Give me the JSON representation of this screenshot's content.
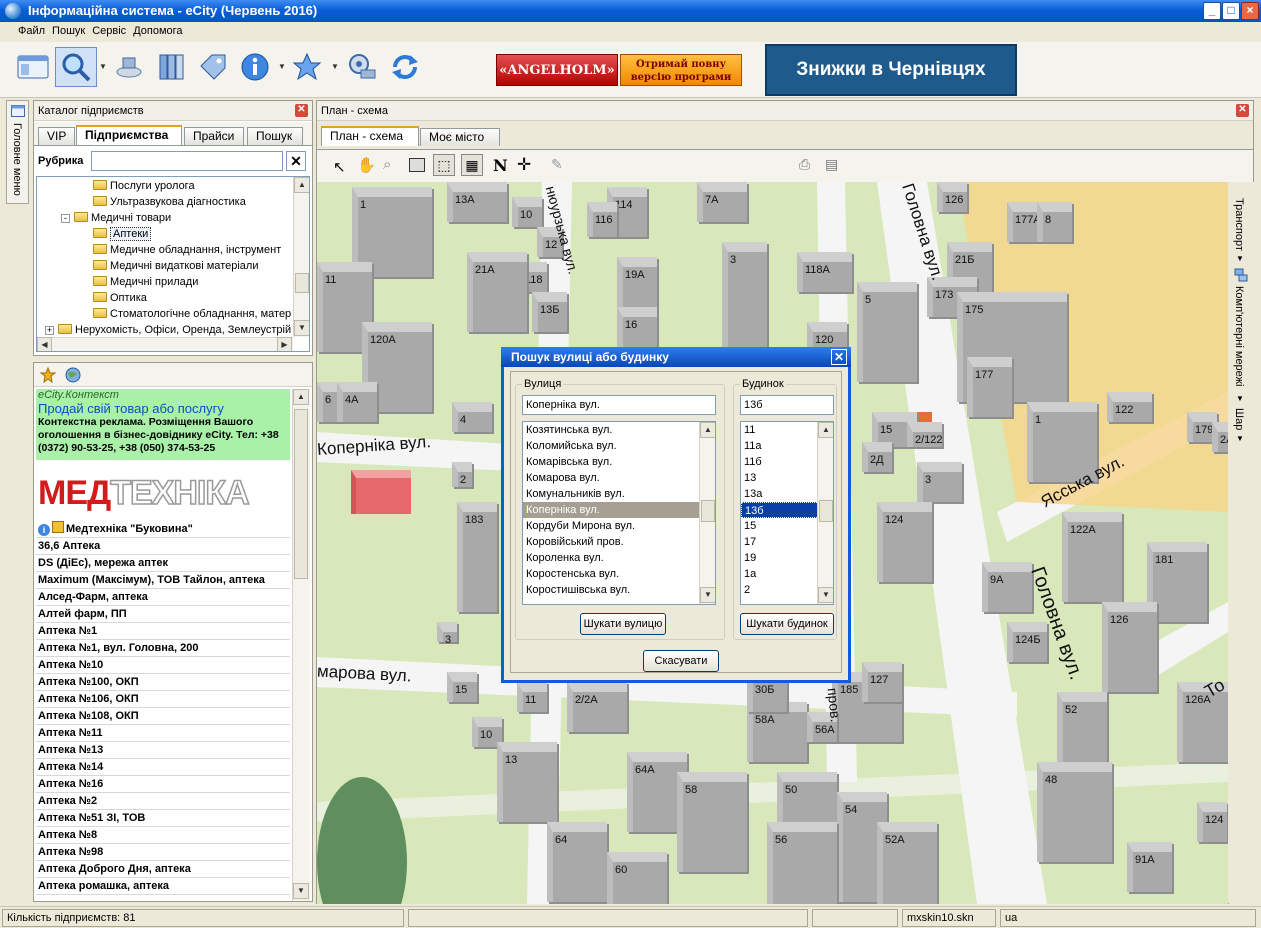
{
  "window": {
    "title": "Інформаційна система - eCity (Червень 2016)"
  },
  "menu": [
    "Файл",
    "Пошук",
    "Сервіс",
    "Допомога"
  ],
  "ads": {
    "angelholm": "«ANGELHOLM»",
    "full_version_line1": "Отримай повну",
    "full_version_line2": "версію програми",
    "discounts": "Знижки в Чернівцях"
  },
  "left_strip": {
    "label": "Головне меню"
  },
  "catalog": {
    "title": "Каталог підприємств",
    "tabs": [
      "VIP",
      "Підприємства",
      "Прайси",
      "Пошук"
    ],
    "active_tab": "Підприємства",
    "rubric_label": "Рубрика",
    "rubric_value": "",
    "tree": [
      "Послуги уролога",
      "Ультразвукова діагностика",
      "Медичні товари",
      "Аптеки",
      "Медичне обладнання, інструмент",
      "Медичні видаткові матеріали",
      "Медичні прилади",
      "Оптика",
      "Стоматологічне обладнання, матер",
      "Нерухомість, Офіси, Оренда, Землеустрій"
    ]
  },
  "ad_block": {
    "brand": "eCity.Контекст",
    "headline": "Продай свій товар або послугу",
    "body": "Контекстна реклама. Розміщення Вашого оголошення в бізнес-довіднику eCity. Тел: +38 (0372) 90-53-25, +38 (050) 374-53-25",
    "logo_part1": "МЕД",
    "logo_part2": "ТЕХНІКА"
  },
  "companies": [
    "Медтехніка \"Буковина\"",
    "36,6 Аптека",
    "DS (ДіЕс), мережа аптек",
    "Maximum (Максімум), ТОВ Тайлон, аптека",
    "Алсед-Фарм, аптека",
    "Алтей фарм, ПП",
    "Аптека №1",
    "Аптека №1, вул. Головна, 200",
    "Аптека №10",
    "Аптека №100, ОКП",
    "Аптека №106, ОКП",
    "Аптека №108, ОКП",
    "Аптека №11",
    "Аптека №13",
    "Аптека №14",
    "Аптека №16",
    "Аптека №2",
    "Аптека №51 ЗІ, ТОВ",
    "Аптека №8",
    "Аптека №98",
    "Аптека Доброго Дня, аптека",
    "Аптека ромашка, аптека"
  ],
  "map_panel": {
    "title": "План - схема",
    "tabs": [
      "План - схема",
      "Моє місто"
    ],
    "active_tab": "План - схема"
  },
  "map": {
    "streets": [
      "Коперніка вул.",
      "Головна вул.",
      "Ясська вул.",
      "марова вул.",
      "нюурзька вул.",
      "пров.",
      "Головна вул.",
      "То"
    ],
    "buildings": [
      "13А",
      "7А",
      "10",
      "114",
      "116",
      "1",
      "12",
      "19А",
      "3",
      "118А",
      "118",
      "11",
      "21А",
      "13Б",
      "16",
      "5",
      "120",
      "120А",
      "21Б",
      "173",
      "175",
      "177",
      "177А",
      "8",
      "6",
      "4А",
      "4",
      "2",
      "15",
      "2/122",
      "2Д",
      "122",
      "1",
      "179",
      "2А",
      "3",
      "124",
      "122А",
      "181",
      "183",
      "9А",
      "124Б",
      "126",
      "185",
      "52",
      "126А",
      "2/2А",
      "58А",
      "56А",
      "10",
      "13",
      "64А",
      "58",
      "50",
      "54",
      "48",
      "64",
      "56",
      "60",
      "52А",
      "91А",
      "11",
      "15",
      "30Б",
      "127",
      "124",
      "126",
      "3",
      "2"
    ]
  },
  "right_strip": [
    "Транспорт",
    "Комп'ютерні мережі",
    "Шар"
  ],
  "dialog": {
    "title": "Пошук вулиці або будинку",
    "street_group": "Вулиця",
    "street_value": "Коперніка вул.",
    "streets": [
      "Козятинська вул.",
      "Коломийська вул.",
      "Комарівська вул.",
      "Комарова вул.",
      "Комунальників вул.",
      "Коперніка вул.",
      "Кордуби Мирона вул.",
      "Коровійський пров.",
      "Короленка вул.",
      "Коростенська вул.",
      "Коростишівська вул."
    ],
    "selected_street": "Коперніка вул.",
    "house_group": "Будинок",
    "house_value": "13б",
    "houses": [
      "11",
      "11а",
      "11б",
      "13",
      "13а",
      "13б",
      "15",
      "17",
      "19",
      "1а",
      "2"
    ],
    "selected_house": "13б",
    "find_street": "Шукати вулицю",
    "find_house": "Шукати будинок",
    "cancel": "Скасувати"
  },
  "status": {
    "count": "Кількість підприємств: 81",
    "skin": "mxskin10.skn",
    "lang": "ua"
  },
  "colors": {
    "title_blue": "#0653c7",
    "selection_gray": "#a59f92",
    "highlight_red": "#e8696b",
    "road": "#f5f5f5",
    "grass": "#d9e8bb"
  }
}
